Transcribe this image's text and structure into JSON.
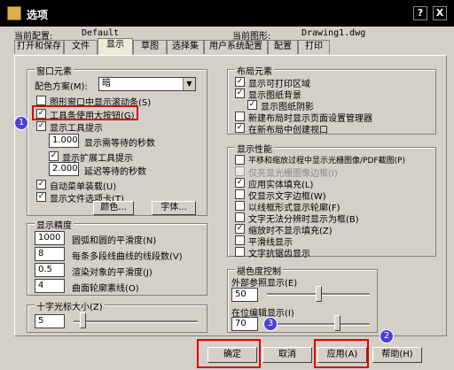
{
  "window": {
    "title": "选项",
    "help_glyph": "?",
    "close_glyph": "X"
  },
  "profile": {
    "current_config_label": "当前配置:",
    "current_config_value": "Default",
    "current_drawing_label": "当前图形:",
    "current_drawing_value": "Drawing1.dwg"
  },
  "tabs": [
    {
      "label": "打开和保存"
    },
    {
      "label": "文件"
    },
    {
      "label": "显示"
    },
    {
      "label": "草图"
    },
    {
      "label": "选择集"
    },
    {
      "label": "用户系统配置"
    },
    {
      "label": "配置"
    },
    {
      "label": "打印"
    }
  ],
  "window_elements": {
    "group_label": "窗口元素",
    "color_scheme_label": "配色方案(M):",
    "color_scheme_value": "暗",
    "checkboxes": [
      {
        "label": "图形窗口中显示滚动条(S)",
        "checked": false
      },
      {
        "label": "工具条使用大按钮(G)",
        "checked": true
      },
      {
        "label": "显示工具提示",
        "checked": true
      },
      {
        "label": "显示扩展工具提示",
        "checked": true
      },
      {
        "label": "自动菜单装载(U)",
        "checked": true
      },
      {
        "label": "显示文件选项卡(T)",
        "checked": true
      }
    ],
    "tooltip_delay_value": "1.000",
    "tooltip_delay_label": "显示需等待的秒数",
    "ext_delay_value": "2.000",
    "ext_delay_label": "延迟等待的秒数",
    "colors_button": "颜色...",
    "fonts_button": "字体..."
  },
  "display_resolution": {
    "group_label": "显示精度",
    "rows": [
      {
        "value": "1000",
        "label": "圆弧和圆的平滑度(N)"
      },
      {
        "value": "8",
        "label": "每条多段线曲线的线段数(V)"
      },
      {
        "value": "0.5",
        "label": "渲染对象的平滑度(J)"
      },
      {
        "value": "4",
        "label": "曲面轮廓素线(O)"
      }
    ]
  },
  "crosshair": {
    "group_label": "十字光标大小(Z)",
    "value": "5",
    "level_percent": 5
  },
  "layout_elements": {
    "group_label": "布局元素",
    "items": [
      {
        "label": "显示可打印区域",
        "checked": true
      },
      {
        "label": "显示图纸背景",
        "checked": true
      },
      {
        "label": "显示图纸阴影",
        "checked": true
      },
      {
        "label": "新建布局时显示页面设置管理器",
        "checked": false
      },
      {
        "label": "在新布局中创建视口",
        "checked": true
      }
    ]
  },
  "display_performance": {
    "group_label": "显示性能",
    "items": [
      {
        "label": "平移和缩放过程中显示光栅图像/PDF截图(P)",
        "checked": false,
        "disabled": false
      },
      {
        "label": "仅亮显光栅图像边框(I)",
        "checked": false,
        "disabled": true
      },
      {
        "label": "应用实体填充(L)",
        "checked": true,
        "disabled": false
      },
      {
        "label": "仅显示文字边框(W)",
        "checked": false,
        "disabled": false
      },
      {
        "label": "以线框形式显示轮廓(F)",
        "checked": false,
        "disabled": false
      },
      {
        "label": "文字无法分辨时显示为框(B)",
        "checked": false,
        "disabled": false
      },
      {
        "label": "缩放时不显示填充(Z)",
        "checked": true,
        "disabled": false
      },
      {
        "label": "平滑线显示",
        "checked": false,
        "disabled": false
      },
      {
        "label": "文字抗锯齿显示",
        "checked": false,
        "disabled": false
      }
    ]
  },
  "fade_control": {
    "group_label": "褪色度控制",
    "xref_label": "外部参照显示(E)",
    "xref_value": "50",
    "xref_level_percent": 50,
    "inplace_label": "在位编辑显示(I)",
    "inplace_value": "70",
    "inplace_level_percent": 70
  },
  "buttons": {
    "ok": "确定",
    "cancel": "取消",
    "apply": "应用(A)",
    "help": "帮助(H)"
  },
  "annotations": [
    "1",
    "2",
    "3"
  ]
}
